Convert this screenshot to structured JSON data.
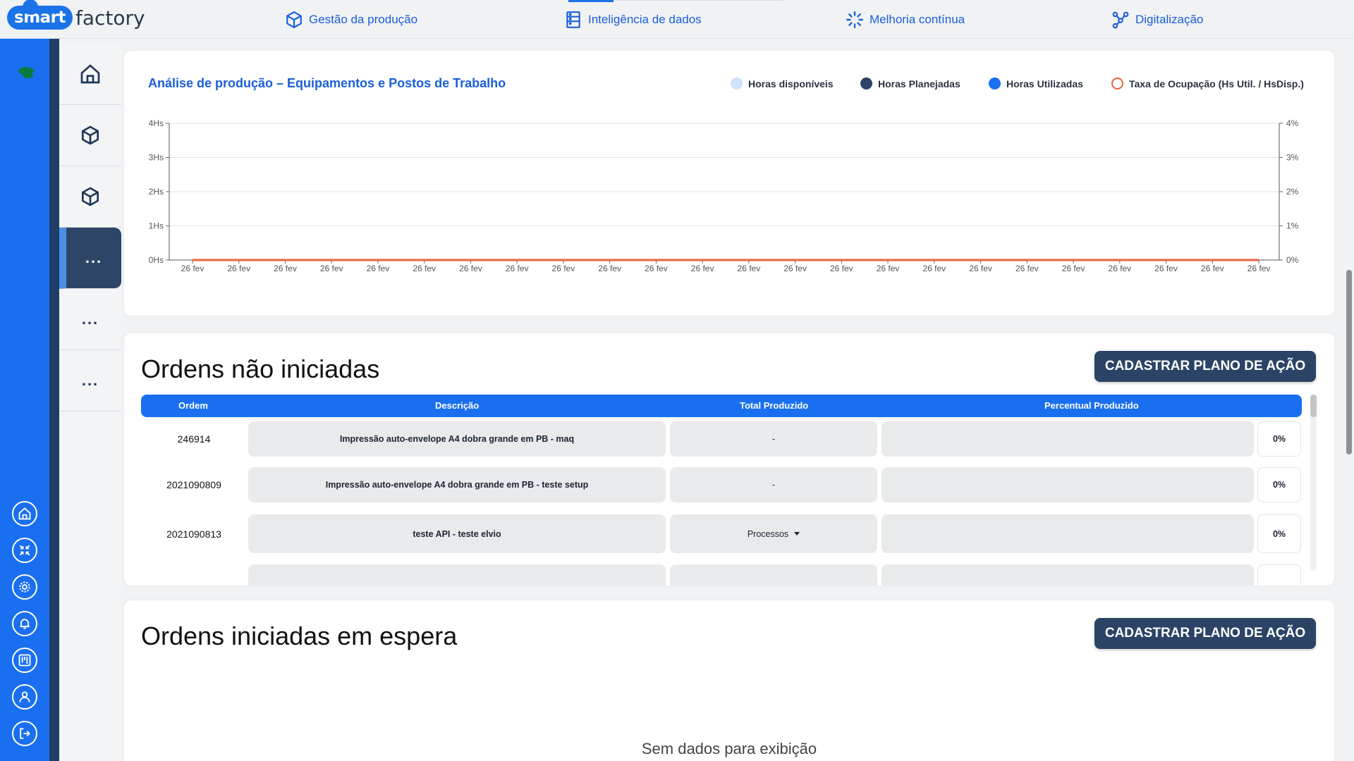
{
  "app": {
    "logo_left": "smart",
    "logo_right": "factory"
  },
  "topnav": [
    {
      "label": "Gestão da produção",
      "icon": "cube-icon"
    },
    {
      "label": "Inteligência de dados",
      "icon": "server-icon"
    },
    {
      "label": "Melhoria contínua",
      "icon": "spinner-icon"
    },
    {
      "label": "Digitalização",
      "icon": "nodes-icon"
    }
  ],
  "rail_icons": [
    "home-icon",
    "collapse-icon",
    "settings-icon",
    "bell-icon",
    "board-icon",
    "user-icon",
    "logout-icon"
  ],
  "sidebar": {
    "items": [
      {
        "type": "icon",
        "icon": "home-icon"
      },
      {
        "type": "icon",
        "icon": "box-icon"
      },
      {
        "type": "icon",
        "icon": "box-icon"
      },
      {
        "type": "dots",
        "label": "..."
      },
      {
        "type": "dots",
        "label": "..."
      },
      {
        "type": "dots",
        "label": "..."
      }
    ]
  },
  "chart": {
    "title": "Análise de produção – Equipamentos e Postos de Trabalho",
    "legend": [
      {
        "label": "Horas disponíveis",
        "color": "#cfe3fb"
      },
      {
        "label": "Horas Planejadas",
        "color": "#2b4466"
      },
      {
        "label": "Horas Utilizadas",
        "color": "#1a6ff0"
      },
      {
        "label": "Taxa de Ocupação (Hs Util. / HsDisp.)",
        "color": "#e8643c"
      }
    ]
  },
  "chart_data": {
    "type": "line",
    "title": "Análise de produção – Equipamentos e Postos de Trabalho",
    "x": [
      "26 fev",
      "26 fev",
      "26 fev",
      "26 fev",
      "26 fev",
      "26 fev",
      "26 fev",
      "26 fev",
      "26 fev",
      "26 fev",
      "26 fev",
      "26 fev",
      "26 fev",
      "26 fev",
      "26 fev",
      "26 fev",
      "26 fev",
      "26 fev",
      "26 fev",
      "26 fev",
      "26 fev",
      "26 fev",
      "26 fev",
      "26 fev"
    ],
    "y_left_ticks": [
      "0Hs",
      "1Hs",
      "2Hs",
      "3Hs",
      "4Hs"
    ],
    "y_right_ticks": [
      "0%",
      "1%",
      "2%",
      "3%",
      "4%"
    ],
    "ylim_left": [
      0,
      4
    ],
    "ylim_right": [
      0,
      4
    ],
    "grid": true,
    "legend_position": "top-right",
    "series": [
      {
        "name": "Horas disponíveis",
        "values": [
          0,
          0,
          0,
          0,
          0,
          0,
          0,
          0,
          0,
          0,
          0,
          0,
          0,
          0,
          0,
          0,
          0,
          0,
          0,
          0,
          0,
          0,
          0,
          0
        ]
      },
      {
        "name": "Horas Planejadas",
        "values": [
          0,
          0,
          0,
          0,
          0,
          0,
          0,
          0,
          0,
          0,
          0,
          0,
          0,
          0,
          0,
          0,
          0,
          0,
          0,
          0,
          0,
          0,
          0,
          0
        ]
      },
      {
        "name": "Horas Utilizadas",
        "values": [
          0,
          0,
          0,
          0,
          0,
          0,
          0,
          0,
          0,
          0,
          0,
          0,
          0,
          0,
          0,
          0,
          0,
          0,
          0,
          0,
          0,
          0,
          0,
          0
        ]
      },
      {
        "name": "Taxa de Ocupação (Hs Util. / HsDisp.)",
        "values": [
          0,
          0,
          0,
          0,
          0,
          0,
          0,
          0,
          0,
          0,
          0,
          0,
          0,
          0,
          0,
          0,
          0,
          0,
          0,
          0,
          0,
          0,
          0,
          0
        ]
      }
    ]
  },
  "orders": {
    "title": "Ordens não iniciadas",
    "action_button": "CADASTRAR PLANO DE AÇÃO",
    "columns": [
      "Ordem",
      "Descrição",
      "Total Produzido",
      "Percentual Produzido"
    ],
    "rows": [
      {
        "order": "246914",
        "description": "Impressão auto-envelope A4 dobra grande em PB - maq",
        "total": "-",
        "percent": "0%"
      },
      {
        "order": "2021090809",
        "description": "Impressão auto-envelope A4 dobra grande em PB - teste setup",
        "total": "-",
        "percent": "0%"
      },
      {
        "order": "2021090813",
        "description": "teste API - teste elvio",
        "total": "Processos",
        "percent": "0%"
      }
    ]
  },
  "waiting": {
    "title": "Ordens iniciadas em espera",
    "action_button": "CADASTRAR PLANO DE AÇÃO",
    "empty": "Sem dados para exibição"
  }
}
